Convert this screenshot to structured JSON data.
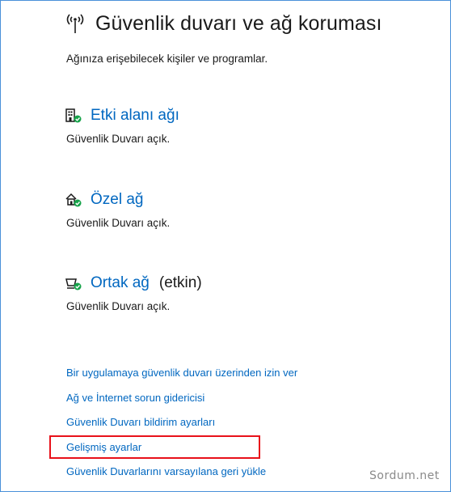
{
  "page": {
    "title": "Güvenlik duvarı ve ağ koruması",
    "subtitle": "Ağınıza erişebilecek kişiler ve programlar.",
    "header_icon": "wifi-antenna-icon"
  },
  "networks": [
    {
      "icon": "domain-network-icon",
      "label": "Etki alanı ağı",
      "status": "Güvenlik Duvarı açık.",
      "active_tag": ""
    },
    {
      "icon": "private-network-icon",
      "label": "Özel ağ",
      "status": "Güvenlik Duvarı açık.",
      "active_tag": ""
    },
    {
      "icon": "public-network-icon",
      "label": "Ortak ağ",
      "status": "Güvenlik Duvarı açık.",
      "active_tag": "(etkin)"
    }
  ],
  "links": [
    "Bir uygulamaya güvenlik duvarı üzerinden izin ver",
    "Ağ ve İnternet sorun gidericisi",
    "Güvenlik Duvarı bildirim ayarları",
    "Gelişmiş ayarlar",
    "Güvenlik Duvarlarını varsayılana geri yükle"
  ],
  "watermark": "Sordum.net",
  "colors": {
    "link": "#0067c0",
    "check_green": "#16a34a",
    "highlight": "#e8111a",
    "border": "#4a90d9"
  }
}
